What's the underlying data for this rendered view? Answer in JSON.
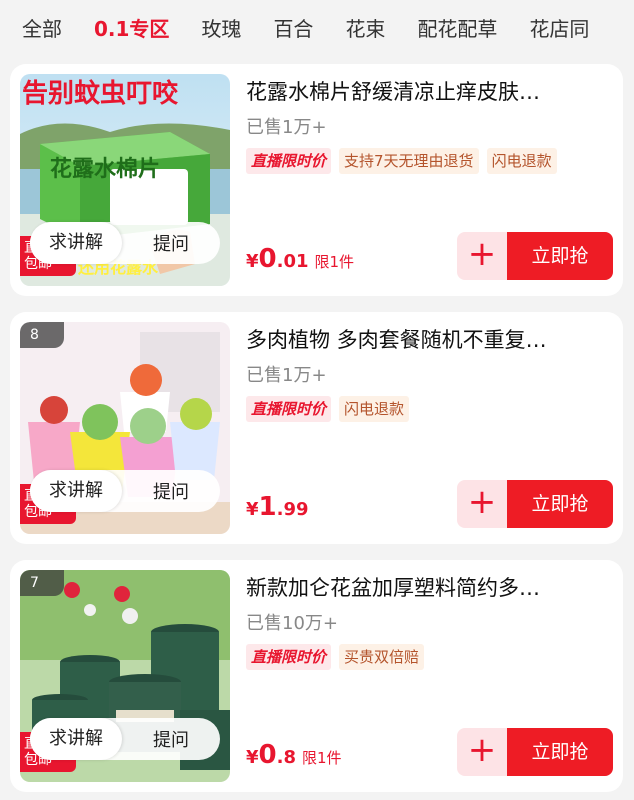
{
  "tabs": [
    "全部",
    "0.1专区",
    "玫瑰",
    "百合",
    "花束",
    "配花配草",
    "花店同"
  ],
  "active_tab": 1,
  "products": [
    {
      "rank": "",
      "thumb_banner": "告别蚊虫叮咬",
      "thumb_box_label": "花露水棉片",
      "thumb_bottom_text": "还用花露水",
      "promo_corner": "直播\n包邮",
      "ask_left": "求讲解",
      "ask_right": "提问",
      "title": "花露水棉片舒缓清凉止痒皮肤…",
      "sold": "已售1万+",
      "tags": [
        {
          "text": "直播限时价",
          "kind": "live"
        },
        {
          "text": "支持7天无理由退货",
          "kind": "normal"
        },
        {
          "text": "闪电退款",
          "kind": "normal"
        }
      ],
      "price_symbol": "¥",
      "price_int": "0",
      "price_dec": ".01",
      "limit": "限1件",
      "add_label": "+",
      "buy_label": "立即抢"
    },
    {
      "rank": "8",
      "promo_corner": "直播\n包邮",
      "ask_left": "求讲解",
      "ask_right": "提问",
      "title": "多肉植物 多肉套餐随机不重复…",
      "sold": "已售1万+",
      "tags": [
        {
          "text": "直播限时价",
          "kind": "live"
        },
        {
          "text": "闪电退款",
          "kind": "normal"
        }
      ],
      "price_symbol": "¥",
      "price_int": "1",
      "price_dec": ".99",
      "limit": "",
      "add_label": "+",
      "buy_label": "立即抢"
    },
    {
      "rank": "7",
      "promo_corner": "直播\n包邮",
      "ask_left": "求讲解",
      "ask_right": "提问",
      "title": "新款加仑花盆加厚塑料简约多…",
      "sold": "已售10万+",
      "tags": [
        {
          "text": "直播限时价",
          "kind": "live"
        },
        {
          "text": "买贵双倍赔",
          "kind": "normal"
        }
      ],
      "price_symbol": "¥",
      "price_int": "0",
      "price_dec": ".8",
      "limit": "限1件",
      "add_label": "+",
      "buy_label": "立即抢"
    }
  ],
  "colors": {
    "accent": "#e8162f",
    "buy_button": "#ee1c25",
    "add_button_bg": "#fde3e6",
    "live_tag_bg": "#fde8ea",
    "normal_tag_bg": "#fdf1e6",
    "normal_tag_text": "#b4542c"
  }
}
